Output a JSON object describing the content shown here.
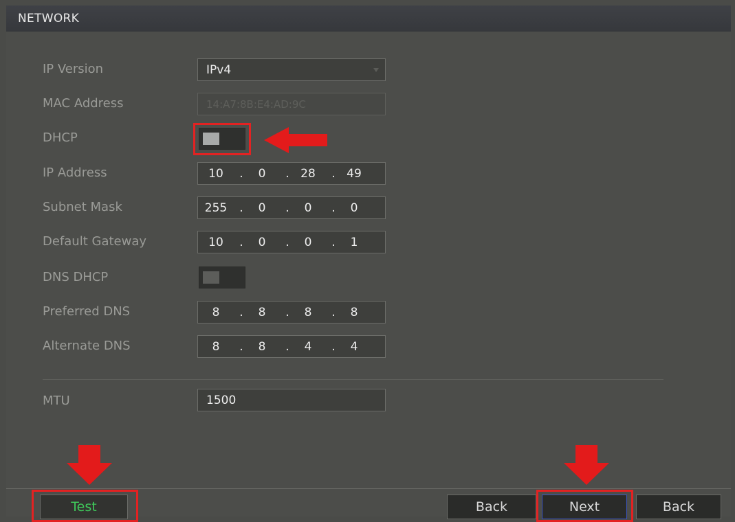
{
  "window": {
    "title": "NETWORK"
  },
  "form": {
    "ip_version": {
      "label": "IP Version",
      "value": "IPv4"
    },
    "mac_address": {
      "label": "MAC Address",
      "value": "14:A7:8B:E4:AD:9C"
    },
    "dhcp": {
      "label": "DHCP",
      "enabled": true
    },
    "ip_address": {
      "label": "IP Address",
      "octets": [
        "10",
        "0",
        "28",
        "49"
      ]
    },
    "subnet_mask": {
      "label": "Subnet Mask",
      "octets": [
        "255",
        "0",
        "0",
        "0"
      ]
    },
    "default_gateway": {
      "label": "Default Gateway",
      "octets": [
        "10",
        "0",
        "0",
        "1"
      ]
    },
    "dns_dhcp": {
      "label": "DNS DHCP",
      "enabled": false
    },
    "preferred_dns": {
      "label": "Preferred DNS",
      "octets": [
        "8",
        "8",
        "8",
        "8"
      ]
    },
    "alternate_dns": {
      "label": "Alternate DNS",
      "octets": [
        "8",
        "8",
        "4",
        "4"
      ]
    },
    "mtu": {
      "label": "MTU",
      "value": "1500"
    }
  },
  "separator": ".",
  "buttons": {
    "test": "Test",
    "back_1": "Back",
    "next": "Next",
    "back_2": "Back"
  },
  "annotations": {
    "arrow_color": "#e31b1b",
    "highlight_color": "#e32222"
  },
  "icons": {
    "dropdown": "caret-down-icon",
    "annotation_arrow_left": "red-arrow-left-icon",
    "annotation_arrow_down": "red-arrow-down-icon"
  }
}
